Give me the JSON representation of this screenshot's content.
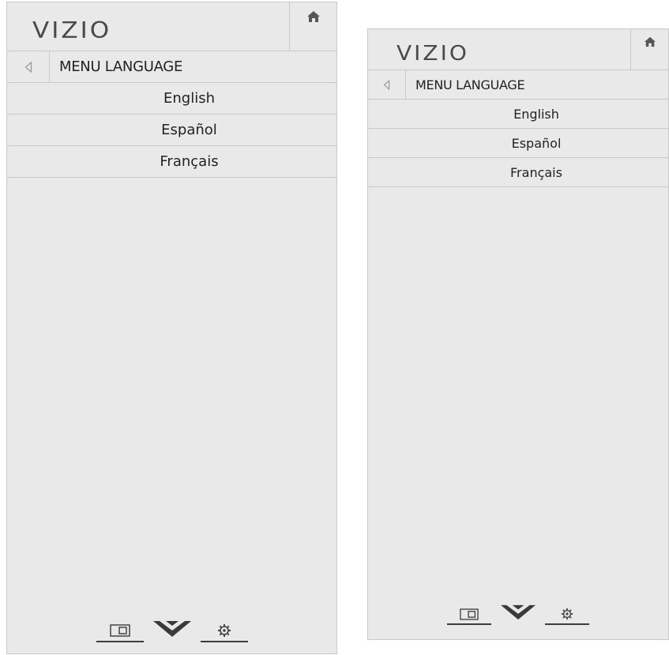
{
  "brand": {
    "logo_text": "VIZIO"
  },
  "menu": {
    "title": "MENU LANGUAGE",
    "options": [
      "English",
      "Español",
      "Français"
    ]
  },
  "icons": {
    "home": "home-icon",
    "back": "back-triangle-icon",
    "widget": "widget-icon",
    "vizio_v": "vizio-v-icon",
    "settings": "gear-icon"
  },
  "colors": {
    "panel_background": "#e9e9e9",
    "divider": "#c9c9c9",
    "logo": "#4a4a4a",
    "text": "#222222"
  }
}
